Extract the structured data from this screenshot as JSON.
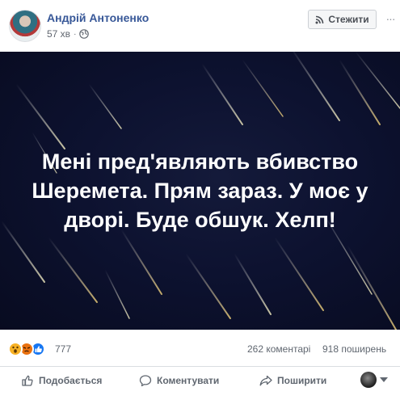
{
  "post": {
    "author": "Андрій Антоненко",
    "time": "57 хв",
    "separator": "·",
    "follow_label": "Стежити",
    "more_label": "···",
    "image_text": "Мені пред'являють вбивство Шеремета. Прям зараз. У моє у дворі. Буде обшук. Хелп!"
  },
  "reactions": {
    "icons": [
      "wow",
      "angry",
      "like"
    ],
    "count": "777",
    "comments": "262 коментарі",
    "shares": "918 поширень"
  },
  "actions": {
    "like": "Подобається",
    "comment": "Коментувати",
    "share": "Поширити"
  },
  "colors": {
    "author_link": "#385898",
    "image_background": "#0d1230",
    "wow": "#f7b125",
    "angry": "#e9710f",
    "like": "#1877f2"
  }
}
